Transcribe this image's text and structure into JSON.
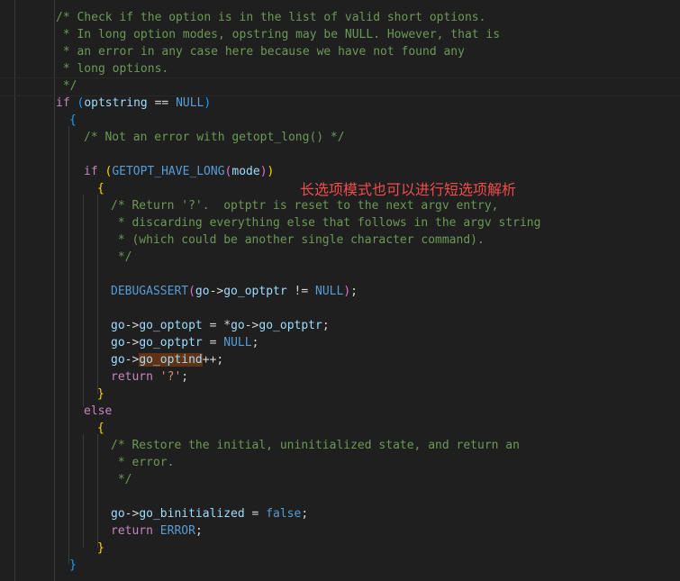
{
  "editor": {
    "lines": [
      "/* Check if the option is in the list of valid short options.",
      " * In long option modes, opstring may be NULL. However, that is",
      " * an error in any case here because we have not found any",
      " * long options.",
      " */",
      "if",
      "(",
      "optstring",
      "==",
      "NULL",
      ")",
      "{",
      "/* Not an error with getopt_long() */",
      "if",
      "(",
      "GETOPT_HAVE_LONG",
      "(",
      "mode",
      ")",
      ")",
      "{",
      "/* Return '?'.  optptr is reset to the next argv entry,",
      " * discarding everything else that follows in the argv string",
      " * (which could be another single character command).",
      " */",
      "DEBUGASSERT",
      "(",
      "go",
      "->",
      "go_optptr",
      "!=",
      "NULL",
      ")",
      ";",
      "go",
      "->",
      "go_optopt",
      "=",
      "*",
      "go",
      "->",
      "go_optptr",
      ";",
      "go",
      "->",
      "go_optptr",
      "=",
      "NULL",
      ";",
      "go",
      "->",
      "go_optind",
      "++;",
      "return",
      "'?'",
      ";",
      "}",
      "else",
      "{",
      "/* Restore the initial, uninitialized state, and return an",
      " * error.",
      " */",
      "go",
      "->",
      "go_binitialized",
      "=",
      "false",
      ";",
      "return",
      "ERROR",
      ";",
      "}",
      "}"
    ]
  },
  "annotation": {
    "text": "长选项模式也可以进行短选项解析"
  },
  "colors": {
    "background": "#1f1f1f",
    "comment": "#6a9955",
    "keyword_control": "#c586c0",
    "keyword_literal": "#569cd6",
    "variable": "#9cdcfe",
    "string": "#ce9178",
    "annotation": "#f14c4c",
    "bracket_gold": "#ffd700",
    "bracket_orchid": "#da70d6",
    "bracket_blue": "#179fff"
  }
}
